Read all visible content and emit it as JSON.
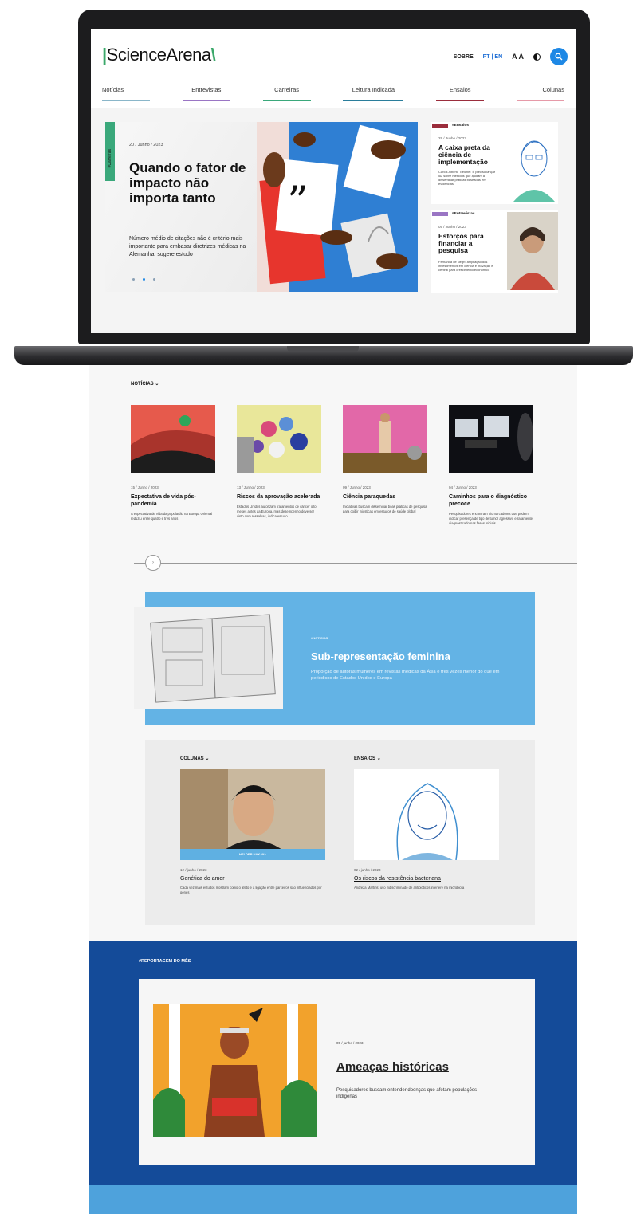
{
  "header": {
    "logo": "ScienceArena",
    "sobre": "SOBRE",
    "lang": "PT | EN",
    "font_size": "A A"
  },
  "nav": [
    {
      "label": "Notícias",
      "color": "#8ab6c9"
    },
    {
      "label": "Entrevistas",
      "color": "#9a75c4"
    },
    {
      "label": "Carreiras",
      "color": "#3aa87b"
    },
    {
      "label": "Leitura Indicada",
      "color": "#2a7d9b"
    },
    {
      "label": "Ensaios",
      "color": "#9b2d3c"
    },
    {
      "label": "Colunas",
      "color": "#e69aa8"
    }
  ],
  "hero": {
    "tag": "#Carreiras",
    "date": "20 / Junho / 2023",
    "title": "Quando o fator de impacto não importa tanto",
    "subtitle": "Número médio de citações não é critério mais importante para embasar diretrizes médicas na Alemanha, sugere estudo"
  },
  "side_cards": [
    {
      "tag": "#Ensaios",
      "tag_color": "#9b2d3c",
      "date": "29 / Junho / 2023",
      "title": "A caixa preta da ciência de implementação",
      "desc": "Carlos Alberto Treichel: É preciso lançar luz sobre métodos que ajudam a disseminar práticas baseadas em evidências"
    },
    {
      "tag": "#Entrevistas",
      "tag_color": "#9a75c4",
      "date": "05 / Junho / 2023",
      "title": "Esforços para financiar a pesquisa",
      "desc": "Fernanda de Negri: ampliação dos investimentos em ciência e inovação é central para crescimento econômico"
    }
  ],
  "noticias": {
    "label": "NOTÍCIAS",
    "items": [
      {
        "date": "15 / Junho / 2023",
        "title": "Expectativa de vida pós-pandemia",
        "desc": "A expectativa de vida da população na Europa Oriental reduziu entre quatro e três anos"
      },
      {
        "date": "13 / Junho / 2023",
        "title": "Riscos da aprovação acelerada",
        "desc": "Estados Unidos autorizam tratamentos de câncer oito meses antes da Europa, mas desempenho deve ser visto com ressalvas, indica estudo"
      },
      {
        "date": "09 / Junho / 2023",
        "title": "Ciência paraquedas",
        "desc": "Iniciativas buscam disseminar boas práticas de pesquisa para coibir injustiças em estudos de saúde global"
      },
      {
        "date": "04 / Junho / 2023",
        "title": "Caminhos para o diagnóstico precoce",
        "desc": "Pesquisadores encontram biomarcadores que podem indicar presença de tipo de tumor agressivo e raramente diagnosticado nas fases iniciais"
      }
    ],
    "slider_arrow": "›"
  },
  "feature": {
    "tag": "#NOTÍCIAS",
    "title": "Sub-representação feminina",
    "subtitle": "Proporção de autoras mulheres em revistas médicas da Ásia é três vezes menor do que em periódicos de Estados Unidos e Europa"
  },
  "colunas": {
    "label": "COLUNAS",
    "name_bar": "HELDER NAKAYA",
    "date": "12 / junho / 2023",
    "title": "Genética do amor",
    "desc": "Cada vez mais estudos mostram como o afeto e a ligação entre parceiros são influenciados por genes"
  },
  "ensaios": {
    "label": "ENSAIOS",
    "date": "02 / junho / 2023",
    "title": "Os riscos da resistência bacteriana",
    "desc": "Andreza Martins: uso indiscriminado de antibióticos interfere na microbiota"
  },
  "reportagem": {
    "label": "#REPORTAGEM DO MÊS",
    "date": "05 / junho / 2023",
    "title": "Ameaças históricas",
    "subtitle": "Pesquisadores buscam entender doenças que afetam populações indígenas"
  },
  "colors": {
    "accent_blue": "#1e88e5",
    "feature_blue": "#63b3e5",
    "report_navy": "#144b99",
    "brand_green": "#3ba86a"
  }
}
